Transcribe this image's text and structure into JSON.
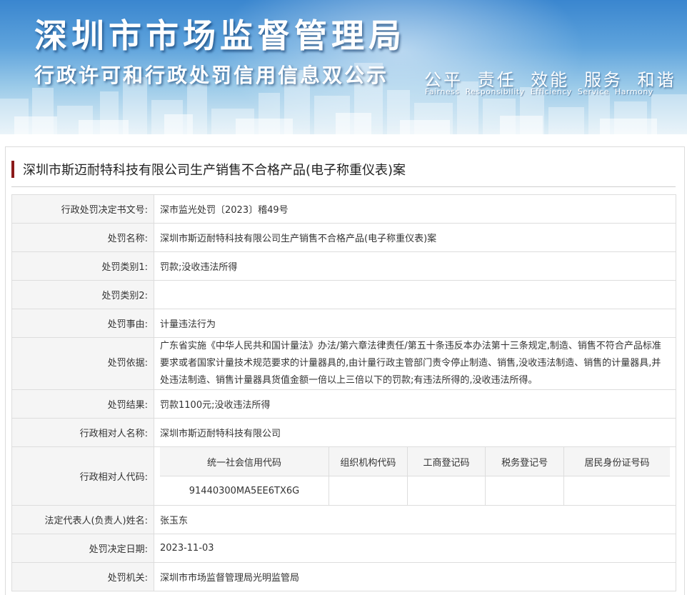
{
  "banner": {
    "title": "深圳市市场监督管理局",
    "subtitle": "行政许可和行政处罚信用信息双公示",
    "slogan_cn": "公平 责任 效能 服务 和谐",
    "slogan_en": "Fairness Responsibility Efficiency Service Harmony"
  },
  "case_title": "深圳市斯迈耐特科技有限公司生产销售不合格产品(电子称重仪表)案",
  "rows": [
    {
      "label": "行政处罚决定书文号:",
      "value": "深市监光处罚〔2023〕稽49号"
    },
    {
      "label": "处罚名称:",
      "value": "深圳市斯迈耐特科技有限公司生产销售不合格产品(电子称重仪表)案"
    },
    {
      "label": "处罚类别1:",
      "value": "罚款;没收违法所得"
    },
    {
      "label": "处罚类别2:",
      "value": ""
    },
    {
      "label": "处罚事由:",
      "value": "计量违法行为"
    },
    {
      "label": "处罚依据:",
      "value": "广东省实施《中华人民共和国计量法》办法/第六章法律责任/第五十条违反本办法第十三条规定,制造、销售不符合产品标准要求或者国家计量技术规范要求的计量器具的,由计量行政主管部门责令停止制造、销售,没收违法制造、销售的计量器具,并处违法制造、销售计量器具货值金额一倍以上三倍以下的罚款;有违法所得的,没收违法所得。"
    },
    {
      "label": "处罚结果:",
      "value": "罚款1100元;没收违法所得"
    },
    {
      "label": "行政相对人名称:",
      "value": "深圳市斯迈耐特科技有限公司"
    }
  ],
  "codes": {
    "label": "行政相对人代码:",
    "headers": [
      "统一社会信用代码",
      "组织机构代码",
      "工商登记码",
      "税务登记号",
      "居民身份证号码"
    ],
    "values": [
      "91440300MA5EE6TX6G",
      "",
      "",
      "",
      ""
    ]
  },
  "rows_after": [
    {
      "label": "法定代表人(负责人)姓名:",
      "value": "张玉东"
    },
    {
      "label": "处罚决定日期:",
      "value": "2023-11-03"
    },
    {
      "label": "处罚机关:",
      "value": "深圳市市场监督管理局光明监管局"
    }
  ]
}
